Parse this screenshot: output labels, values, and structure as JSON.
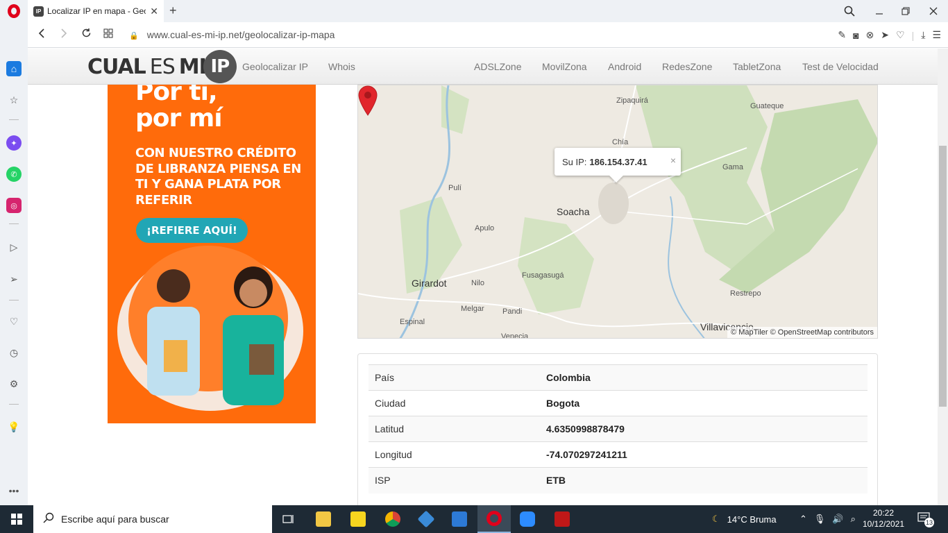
{
  "browser": {
    "tab_title": "Localizar IP en mapa - Geol",
    "tab_favicon_text": "IP",
    "url": "www.cual-es-mi-ip.net/geolocalizar-ip-mapa"
  },
  "site": {
    "logo_part1": "CUAL",
    "logo_part2": "ES",
    "logo_part3": "MI",
    "logo_ip": "IP",
    "nav_left": [
      "Geolocalizar IP",
      "Whois"
    ],
    "nav_right": [
      "ADSLZone",
      "MovilZona",
      "Android",
      "RedesZone",
      "TabletZona",
      "Test de Velocidad"
    ]
  },
  "ad": {
    "headline_1": "Por ti,",
    "headline_2": "por mí",
    "body_lines": [
      "CON NUESTRO CRÉDITO",
      "DE LIBRANZA PIENSA EN",
      "TI Y GANA PLATA POR",
      "REFERIR"
    ],
    "cta": "¡REFIERE AQUÍ!",
    "colors": {
      "bg": "#ff6b0b",
      "cta": "#21a6b5"
    }
  },
  "map": {
    "popup_label": "Su IP:",
    "popup_ip": "186.154.37.41",
    "popup_close": "×",
    "places": [
      "Zipaquirá",
      "Guateque",
      "Chía",
      "Gama",
      "Pulí",
      "Soacha",
      "Apulo",
      "Girardot",
      "Nilo",
      "Fusagasugá",
      "Melgar",
      "Pandi",
      "Espinal",
      "Restrepo",
      "Villavicencio",
      "Venecia"
    ],
    "attribution": "© MapTiler © OpenStreetMap contributors"
  },
  "info": {
    "rows": [
      {
        "key": "País",
        "value": "Colombia"
      },
      {
        "key": "Ciudad",
        "value": "Bogota"
      },
      {
        "key": "Latitud",
        "value": "4.6350998878479"
      },
      {
        "key": "Longitud",
        "value": "-74.070297241211"
      },
      {
        "key": "ISP",
        "value": "ETB"
      }
    ]
  },
  "taskbar": {
    "search_placeholder": "Escribe aquí para buscar",
    "weather": "14°C  Bruma",
    "time": "20:22",
    "date": "10/12/2021",
    "notifications": "13"
  }
}
